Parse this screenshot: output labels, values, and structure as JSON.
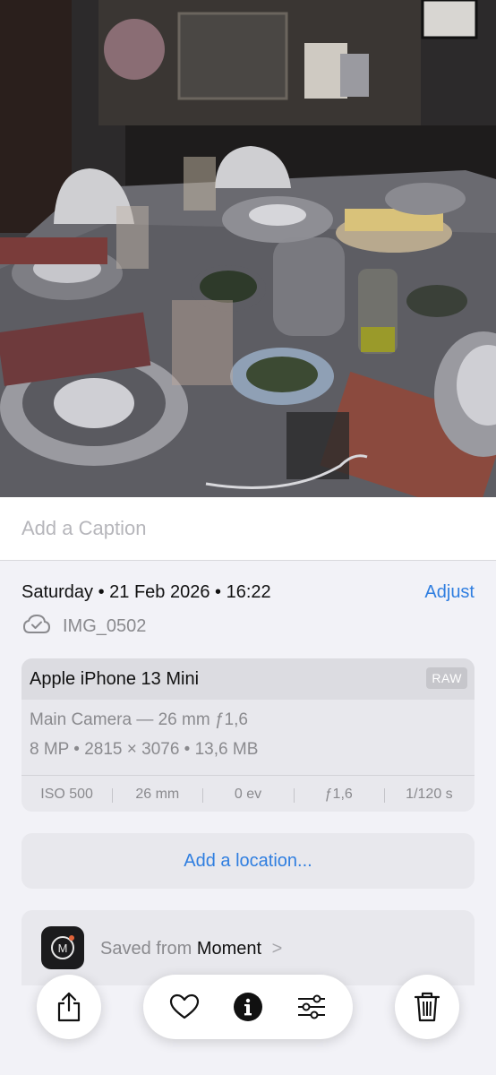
{
  "caption": {
    "placeholder": "Add a Caption"
  },
  "info": {
    "date": "Saturday • 21 Feb 2026 • 16:22",
    "adjust_label": "Adjust",
    "filename": "IMG_0502",
    "icons": {
      "cloud": "icloud-check-icon"
    }
  },
  "camera": {
    "device": "Apple iPhone 13 Mini",
    "format_badge": "RAW",
    "lens": "Main Camera — 26 mm ƒ1,6",
    "details": "8 MP • 2815 × 3076 • 13,6 MB",
    "exif": [
      "ISO 500",
      "26 mm",
      "0 ev",
      "ƒ1,6",
      "1/120 s"
    ]
  },
  "location": {
    "label": "Add a location..."
  },
  "source": {
    "prefix": "Saved from",
    "app": "Moment",
    "chevron": ">"
  },
  "toolbar": {
    "icons": [
      "share-icon",
      "heart-icon",
      "info-icon",
      "adjust-sliders-icon",
      "trash-icon"
    ]
  },
  "colors": {
    "accent": "#2f7ee0",
    "background": "#f2f2f7",
    "card": "#e8e8ed",
    "secondary_text": "#8a8a8e"
  }
}
